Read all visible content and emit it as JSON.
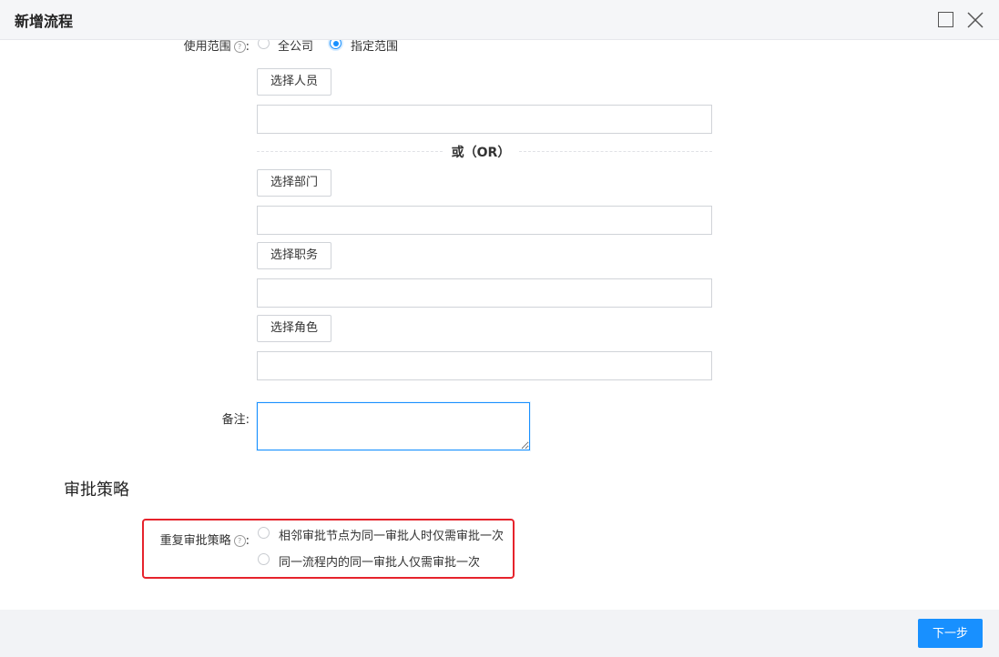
{
  "dialog": {
    "title": "新增流程"
  },
  "scope": {
    "label": "使用范围",
    "help": "?",
    "colon": ":",
    "options": [
      {
        "label": "全公司",
        "checked": false
      },
      {
        "label": "指定范围",
        "checked": true
      }
    ],
    "pickers": [
      {
        "button": "选择人员",
        "value": ""
      },
      {
        "button": "选择部门",
        "value": ""
      },
      {
        "button": "选择职务",
        "value": ""
      },
      {
        "button": "选择角色",
        "value": ""
      }
    ],
    "or_text": "或（OR）"
  },
  "remark": {
    "label": "备注",
    "colon": ":",
    "value": ""
  },
  "approval": {
    "section_title": "审批策略",
    "repeat_label": "重复审批策略",
    "help": "?",
    "colon": ":",
    "options": [
      {
        "label": "相邻审批节点为同一审批人时仅需审批一次",
        "checked": false
      },
      {
        "label": "同一流程内的同一审批人仅需审批一次",
        "checked": false
      }
    ]
  },
  "footer": {
    "next_label": "下一步"
  },
  "colors": {
    "accent": "#1890ff",
    "highlight": "#e6232c"
  }
}
